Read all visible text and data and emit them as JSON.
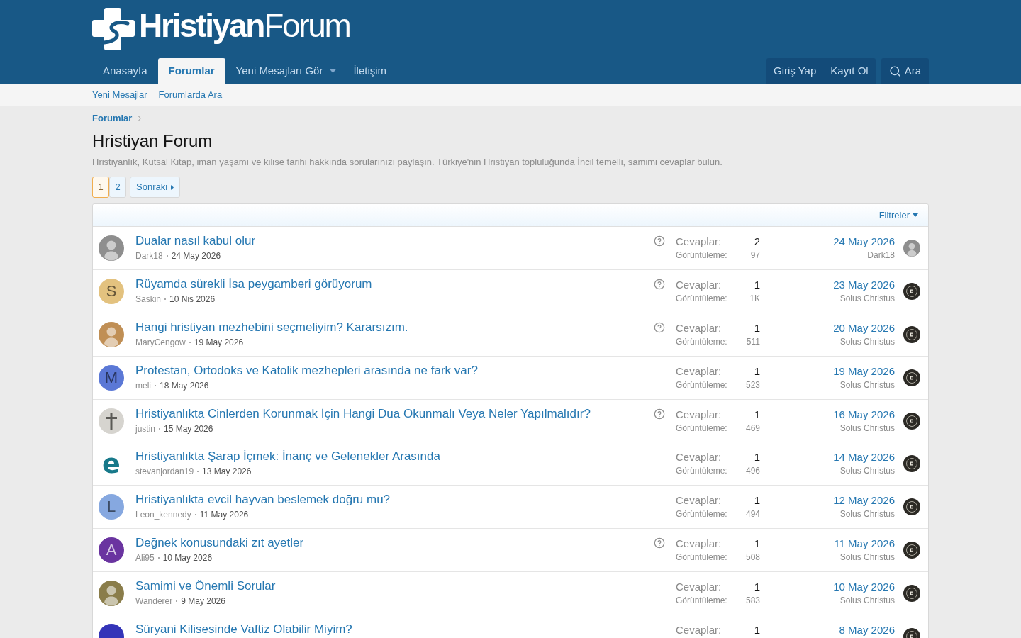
{
  "header": {
    "logo": "**Hristiyan**Forum",
    "nav": [
      {
        "label": "Anasayfa",
        "selected": false,
        "dropdown": false
      },
      {
        "label": "Forumlar",
        "selected": true,
        "dropdown": false
      },
      {
        "label": "Yeni Mesajları Gör",
        "selected": false,
        "dropdown": true
      },
      {
        "label": "İletişim",
        "selected": false,
        "dropdown": false
      }
    ],
    "account": [
      "Giriş Yap",
      "Kayıt Ol"
    ],
    "search": "Ara"
  },
  "subnav": [
    "Yeni Mesajlar",
    "Forumlarda Ara"
  ],
  "breadcrumb": [
    "Forumlar"
  ],
  "title": "Hristiyan Forum",
  "description": "Hristiyanlık, Kutsal Kitap, iman yaşamı ve kilise tarihi hakkında sorularınızı paylaşın. Türkiye'nin Hristiyan topluluğunda İncil temelli, samimi cevaplar bulun.",
  "pagination": {
    "pages": [
      {
        "label": "1",
        "selected": true
      },
      {
        "label": "2",
        "selected": false
      }
    ],
    "next": "Sonraki"
  },
  "filters": "Filtreler",
  "threads": [
    {
      "title": "Dualar nasıl kabul olur",
      "author": "Dark18",
      "date": "24 May 2026",
      "question": true,
      "avatar": {
        "kind": "photo",
        "color": "#8e8e8e"
      },
      "replies_label": "Cevaplar:",
      "replies": "2",
      "views_label": "Görüntüleme:",
      "views": "97",
      "last_date": "24 May 2026",
      "last_user": "Dark18",
      "last_avatar": {
        "kind": "photo",
        "color": "#8e8e8e"
      }
    },
    {
      "title": "Rüyamda sürekli İsa peygamberi görüyorum",
      "author": "Saskin",
      "date": "10 Nis 2026",
      "question": true,
      "avatar": {
        "kind": "letter",
        "letter": "S",
        "color": "#e3c27f"
      },
      "replies_label": "Cevaplar:",
      "replies": "1",
      "views_label": "Görüntüleme:",
      "views": "1K",
      "last_date": "23 May 2026",
      "last_user": "Solus Christus",
      "last_avatar": {
        "kind": "emblem"
      }
    },
    {
      "title": "Hangi hristiyan mezhebini seçmeliyim? Kararsızım.",
      "author": "MaryCengow",
      "date": "19 May 2026",
      "question": true,
      "avatar": {
        "kind": "photo",
        "color": "#c08f55"
      },
      "replies_label": "Cevaplar:",
      "replies": "1",
      "views_label": "Görüntüleme:",
      "views": "511",
      "last_date": "20 May 2026",
      "last_user": "Solus Christus",
      "last_avatar": {
        "kind": "emblem"
      }
    },
    {
      "title": "Protestan, Ortodoks ve Katolik mezhepleri arasında ne fark var?",
      "author": "meli",
      "date": "18 May 2026",
      "question": false,
      "avatar": {
        "kind": "letter",
        "letter": "M",
        "color": "#5b78d6"
      },
      "replies_label": "Cevaplar:",
      "replies": "1",
      "views_label": "Görüntüleme:",
      "views": "523",
      "last_date": "19 May 2026",
      "last_user": "Solus Christus",
      "last_avatar": {
        "kind": "emblem"
      }
    },
    {
      "title": "Hristiyanlıkta Cinlerden Korunmak İçin Hangi Dua Okunmalı Veya Neler Yapılmalıdır?",
      "author": "justin",
      "date": "15 May 2026",
      "question": true,
      "avatar": {
        "kind": "cross"
      },
      "replies_label": "Cevaplar:",
      "replies": "1",
      "views_label": "Görüntüleme:",
      "views": "469",
      "last_date": "16 May 2026",
      "last_user": "Solus Christus",
      "last_avatar": {
        "kind": "emblem"
      }
    },
    {
      "title": "Hristiyanlıkta Şarap İçmek: İnanç ve Gelenekler Arasında",
      "author": "stevanjordan19",
      "date": "13 May 2026",
      "question": false,
      "avatar": {
        "kind": "glyph",
        "letter": "e",
        "color": "#17798a"
      },
      "replies_label": "Cevaplar:",
      "replies": "1",
      "views_label": "Görüntüleme:",
      "views": "496",
      "last_date": "14 May 2026",
      "last_user": "Solus Christus",
      "last_avatar": {
        "kind": "emblem"
      }
    },
    {
      "title": "Hristiyanlıkta evcil hayvan beslemek doğru mu?",
      "author": "Leon_kennedy",
      "date": "11 May 2026",
      "question": false,
      "avatar": {
        "kind": "letter",
        "letter": "L",
        "color": "#86a8e0"
      },
      "replies_label": "Cevaplar:",
      "replies": "1",
      "views_label": "Görüntüleme:",
      "views": "494",
      "last_date": "12 May 2026",
      "last_user": "Solus Christus",
      "last_avatar": {
        "kind": "emblem"
      }
    },
    {
      "title": "Değnek konusundaki zıt ayetler",
      "author": "Ali95",
      "date": "10 May 2026",
      "question": true,
      "avatar": {
        "kind": "letter",
        "letter": "A",
        "color": "#6a34a0"
      },
      "replies_label": "Cevaplar:",
      "replies": "1",
      "views_label": "Görüntüleme:",
      "views": "508",
      "last_date": "11 May 2026",
      "last_user": "Solus Christus",
      "last_avatar": {
        "kind": "emblem"
      }
    },
    {
      "title": "Samimi ve Önemli Sorular",
      "author": "Wanderer",
      "date": "9 May 2026",
      "question": false,
      "avatar": {
        "kind": "photo",
        "color": "#8a7d4a"
      },
      "replies_label": "Cevaplar:",
      "replies": "1",
      "views_label": "Görüntüleme:",
      "views": "583",
      "last_date": "10 May 2026",
      "last_user": "Solus Christus",
      "last_avatar": {
        "kind": "emblem"
      }
    },
    {
      "title": "Süryani Kilisesinde Vaftiz Olabilir Miyim?",
      "question": false,
      "avatar": {
        "kind": "letter",
        "color": "#3434b8"
      },
      "replies_label": "Cevaplar:",
      "replies": "1",
      "last_date": "8 May 2026",
      "last_avatar": {
        "kind": "emblem"
      }
    }
  ]
}
